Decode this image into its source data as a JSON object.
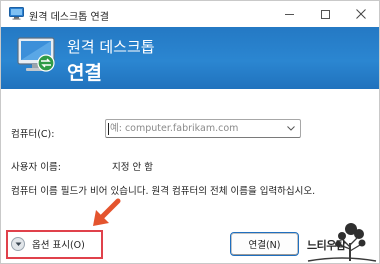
{
  "window": {
    "title": "원격 데스크톱 연결",
    "controls": {
      "minimize": "minimize",
      "maximize": "maximize",
      "close": "close"
    }
  },
  "header": {
    "title": "원격 데스크톱",
    "subtitle": "연결",
    "background_color": "#2479c4"
  },
  "form": {
    "computer_label": "컴퓨터(C):",
    "computer_value": "",
    "computer_placeholder": "예: computer.fabrikam.com",
    "user_label": "사용자 이름:",
    "user_value": "지정 안 함",
    "info_text": "컴퓨터 이름 필드가 비어 있습니다. 원격 컴퓨터의 전체 이름을 입력하십시오."
  },
  "footer": {
    "options_label": "옵션 표시(O)",
    "connect_label": "연결(N)",
    "highlight_color": "#e0414b",
    "arrow_color": "#e4542e"
  },
  "watermark": {
    "text": "느티우탐"
  },
  "icons": {
    "app": "remote-desktop-icon",
    "header": "monitor-connection-icon",
    "options": "chevron-down-icon",
    "combo": "dropdown-arrow-icon"
  }
}
